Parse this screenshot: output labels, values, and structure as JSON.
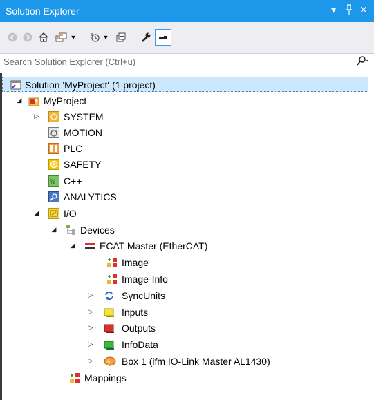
{
  "window": {
    "title": "Solution Explorer",
    "controls": {
      "dropdown": "▾",
      "pin": "ᵖ",
      "close": "✕"
    }
  },
  "toolbar": {
    "icons": [
      "back-icon",
      "forward-icon",
      "home-icon",
      "switch-views-icon",
      "dropdown-icon",
      "pending-changes-filter-icon",
      "dropdown-icon",
      "collapse-all-icon",
      "properties-icon",
      "preview-icon"
    ]
  },
  "search": {
    "placeholder": "Search Solution Explorer (Ctrl+ü)",
    "icon": "search-icon"
  },
  "tree": {
    "solution": "Solution 'MyProject' (1 project)",
    "project": "MyProject",
    "system": "SYSTEM",
    "motion": "MOTION",
    "plc": "PLC",
    "safety": "SAFETY",
    "cpp": "C++",
    "analytics": "ANALYTICS",
    "io": "I/O",
    "devices": "Devices",
    "ecat_master": "ECAT Master (EtherCAT)",
    "image": "Image",
    "image_info": "Image-Info",
    "syncunits": "SyncUnits",
    "inputs": "Inputs",
    "outputs": "Outputs",
    "infodata": "InfoData",
    "box1": "Box 1 (ifm IO-Link Master AL1430)",
    "mappings": "Mappings"
  },
  "colors": {
    "titlebar": "#1c97ea",
    "toolbar": "#eeeef2",
    "selection": "#cce8ff"
  }
}
